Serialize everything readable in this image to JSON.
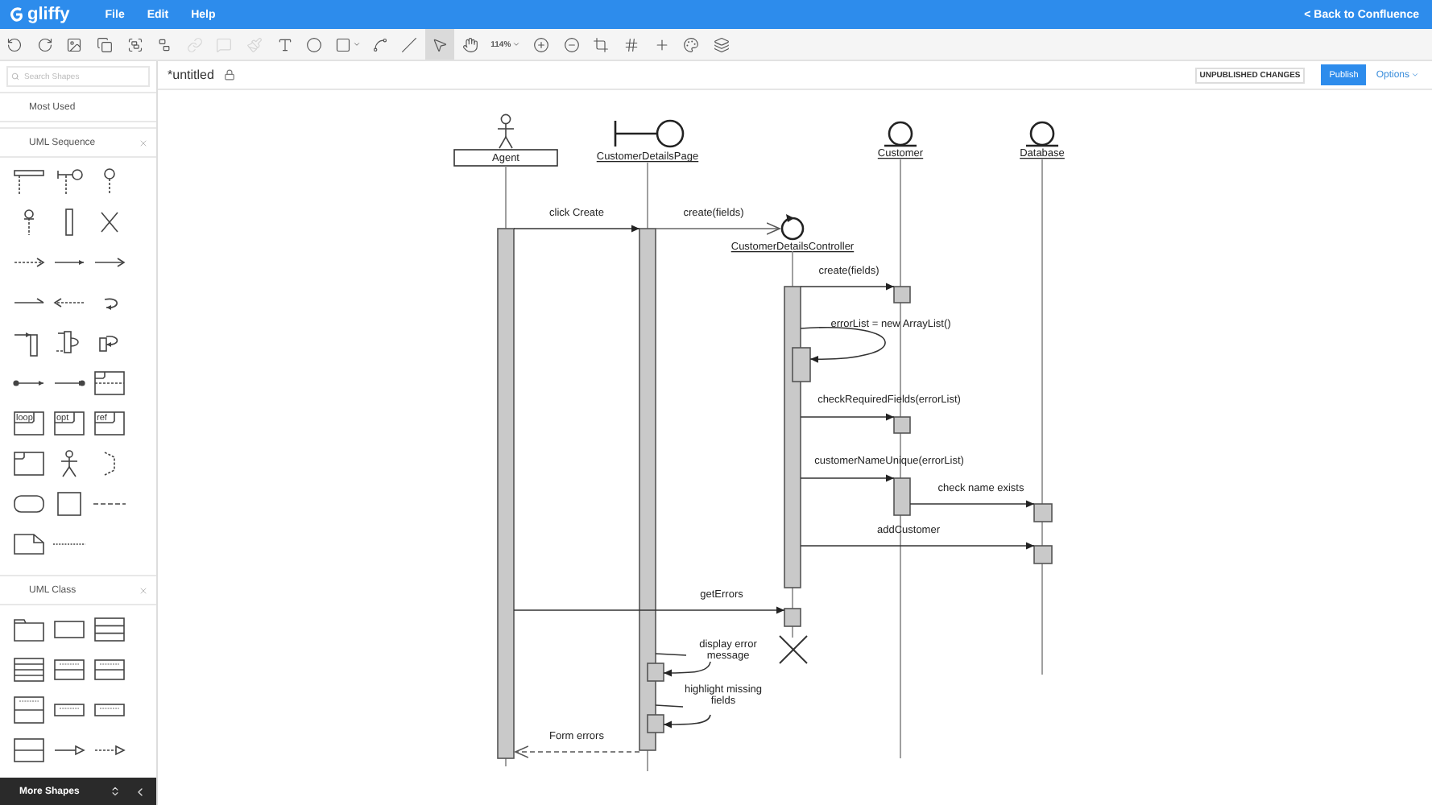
{
  "app": {
    "logo": "gliffy",
    "menu": [
      "File",
      "Edit",
      "Help"
    ],
    "back_link": "< Back to Confluence"
  },
  "toolbar": {
    "tools": [
      {
        "kind": "undo",
        "disabled": false,
        "selected": false
      },
      {
        "kind": "redo",
        "disabled": false,
        "selected": false
      },
      {
        "kind": "image",
        "disabled": false,
        "selected": false
      },
      {
        "kind": "copy",
        "disabled": false,
        "selected": false
      },
      {
        "kind": "group",
        "disabled": false,
        "selected": false
      },
      {
        "kind": "ungroup",
        "disabled": false,
        "selected": false
      },
      {
        "kind": "link",
        "disabled": true,
        "selected": false
      },
      {
        "kind": "comment",
        "disabled": true,
        "selected": false
      },
      {
        "kind": "format",
        "disabled": true,
        "selected": false
      },
      {
        "kind": "text",
        "disabled": false,
        "selected": false
      },
      {
        "kind": "ellipse",
        "disabled": false,
        "selected": false
      },
      {
        "kind": "rectangle",
        "disabled": false,
        "selected": false
      },
      {
        "kind": "connector",
        "disabled": false,
        "selected": false
      },
      {
        "kind": "line",
        "disabled": false,
        "selected": false
      },
      {
        "kind": "pointer",
        "disabled": false,
        "selected": true
      },
      {
        "kind": "hand",
        "disabled": false,
        "selected": false
      },
      {
        "kind": "zoom",
        "label": "114%",
        "disabled": false,
        "selected": false
      },
      {
        "kind": "zoom-in",
        "disabled": false,
        "selected": false
      },
      {
        "kind": "zoom-out",
        "disabled": false,
        "selected": false
      },
      {
        "kind": "crop",
        "disabled": false,
        "selected": false
      },
      {
        "kind": "grid",
        "disabled": false,
        "selected": false
      },
      {
        "kind": "guides",
        "disabled": false,
        "selected": false
      },
      {
        "kind": "theme",
        "disabled": false,
        "selected": false
      },
      {
        "kind": "layers",
        "disabled": false,
        "selected": false
      }
    ]
  },
  "sidebar": {
    "search": {
      "placeholder": "Search Shapes"
    },
    "sections": [
      {
        "title": "Most Used",
        "expanded": false,
        "closable": false
      },
      {
        "title": "UML Sequence",
        "expanded": true,
        "closable": true
      },
      {
        "title": "UML Class",
        "expanded": true,
        "closable": true
      }
    ],
    "fragment_labels": [
      "loop",
      "opt",
      "ref"
    ],
    "footer": "More Shapes"
  },
  "document": {
    "title": "*untitled",
    "status": "UNPUBLISHED CHANGES",
    "publish": "Publish",
    "options": "Options"
  },
  "diagram": {
    "lifelines": [
      {
        "name": "Agent",
        "kind": "actor"
      },
      {
        "name": "CustomerDetailsPage",
        "kind": "boundary"
      },
      {
        "name": "CustomerDetailsController",
        "kind": "control"
      },
      {
        "name": "Customer",
        "kind": "entity"
      },
      {
        "name": "Database",
        "kind": "entity"
      }
    ],
    "messages": [
      {
        "label": "click Create",
        "kind": "sync"
      },
      {
        "label": "create(fields)",
        "kind": "create"
      },
      {
        "label": "create(fields)",
        "kind": "sync"
      },
      {
        "label": "errorList = new ArrayList()",
        "kind": "self"
      },
      {
        "label": "checkRequiredFields(errorList)",
        "kind": "sync"
      },
      {
        "label": "customerNameUnique(errorList)",
        "kind": "sync"
      },
      {
        "label": "check name exists",
        "kind": "sync"
      },
      {
        "label": "addCustomer",
        "kind": "sync"
      },
      {
        "label": "getErrors",
        "kind": "sync"
      },
      {
        "label": "display error message",
        "kind": "note"
      },
      {
        "label": "highlight missing fields",
        "kind": "note"
      },
      {
        "label": "Form errors",
        "kind": "return"
      }
    ]
  }
}
